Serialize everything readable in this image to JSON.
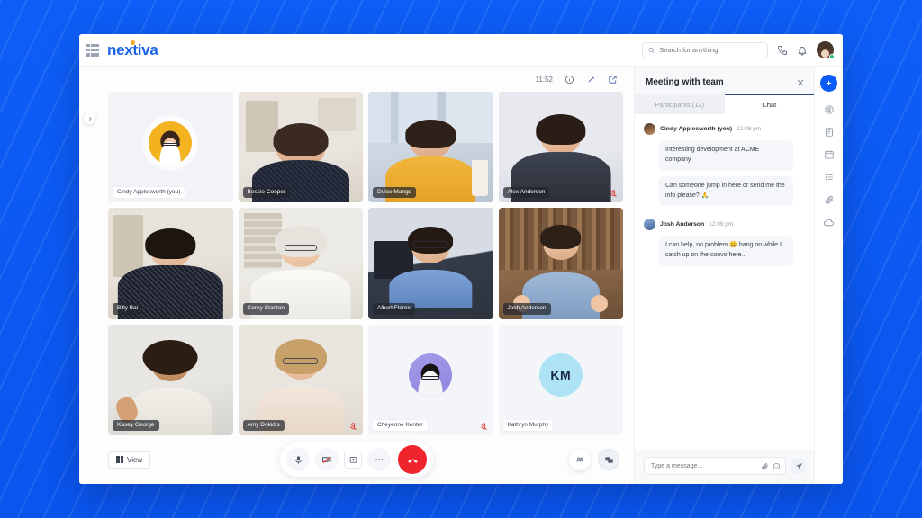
{
  "app": {
    "brand": "nextiva",
    "apps_icon": "grid-apps-icon"
  },
  "topbar": {
    "search_placeholder": "Search for anything",
    "search_value": "",
    "search_icon": "search-icon",
    "phone_icon": "phone-icon",
    "bell_icon": "bell-icon",
    "avatar": "user-avatar"
  },
  "stage": {
    "clock": "11:52",
    "info_icon": "info-icon",
    "pin_icon": "pin-icon",
    "expand_icon": "expand-icon",
    "collapse_icon": "chevron-right-icon"
  },
  "participants": [
    {
      "name": "Cindy Applesworth (you)",
      "muted": false,
      "type": "avatar-self"
    },
    {
      "name": "Bessie Cooper",
      "muted": false,
      "type": "video"
    },
    {
      "name": "Dulce Mango",
      "muted": false,
      "type": "video"
    },
    {
      "name": "Alex Anderson",
      "muted": true,
      "type": "video"
    },
    {
      "name": "Billy Bai",
      "muted": false,
      "type": "video"
    },
    {
      "name": "Corey Stanton",
      "muted": false,
      "type": "video"
    },
    {
      "name": "Albert Flores",
      "muted": false,
      "type": "video"
    },
    {
      "name": "Josh Anderson",
      "muted": false,
      "type": "video"
    },
    {
      "name": "Kasey George",
      "muted": false,
      "type": "video"
    },
    {
      "name": "Amy Dokidis",
      "muted": true,
      "type": "video"
    },
    {
      "name": "Cheyenne Kenter",
      "muted": true,
      "type": "avatar"
    },
    {
      "name": "Kathryn Murphy",
      "muted": false,
      "type": "initials",
      "initials": "KM"
    }
  ],
  "controls": {
    "view_label": "View",
    "mic_icon": "microphone-icon",
    "camera_icon": "camera-off-icon",
    "share_icon": "screen-share-icon",
    "more_icon": "more-options-icon",
    "end_call_icon": "end-call-icon",
    "participants_icon": "participants-icon",
    "chat_icon": "chat-icon"
  },
  "chat_panel": {
    "title": "Meeting with team",
    "close_icon": "close-icon",
    "tabs": [
      {
        "label": "Participants (12)",
        "active": false
      },
      {
        "label": "Chat",
        "active": true
      }
    ],
    "messages": [
      {
        "author": "Cindy Applesworth (you)",
        "time": "12:08 pm",
        "bubbles": [
          "Interesting development at ACME company",
          "Can someone jump in here or send me the info please? 🙏"
        ]
      },
      {
        "author": "Josh Anderson",
        "time": "12:09 pm",
        "bubbles": [
          "I can help, no problem 😀 hang on while I catch up on the convo here..."
        ]
      }
    ],
    "composer": {
      "placeholder": "Type a message...",
      "value": "",
      "attach_icon": "paperclip-icon",
      "emoji_icon": "emoji-icon",
      "send_icon": "send-icon"
    }
  },
  "rail": {
    "items": [
      {
        "icon": "plus-icon"
      },
      {
        "icon": "contact-icon"
      },
      {
        "icon": "book-icon"
      },
      {
        "icon": "calendar-icon"
      },
      {
        "icon": "tasks-icon"
      },
      {
        "icon": "paperclip-icon"
      },
      {
        "icon": "cloud-icon"
      }
    ]
  },
  "colors": {
    "brand_blue": "#1a63e8",
    "accent_orange": "#f5a623",
    "background_blue": "#0b5cf5",
    "end_call_red": "#f0242c",
    "initials_bg": "#ade3f5"
  }
}
